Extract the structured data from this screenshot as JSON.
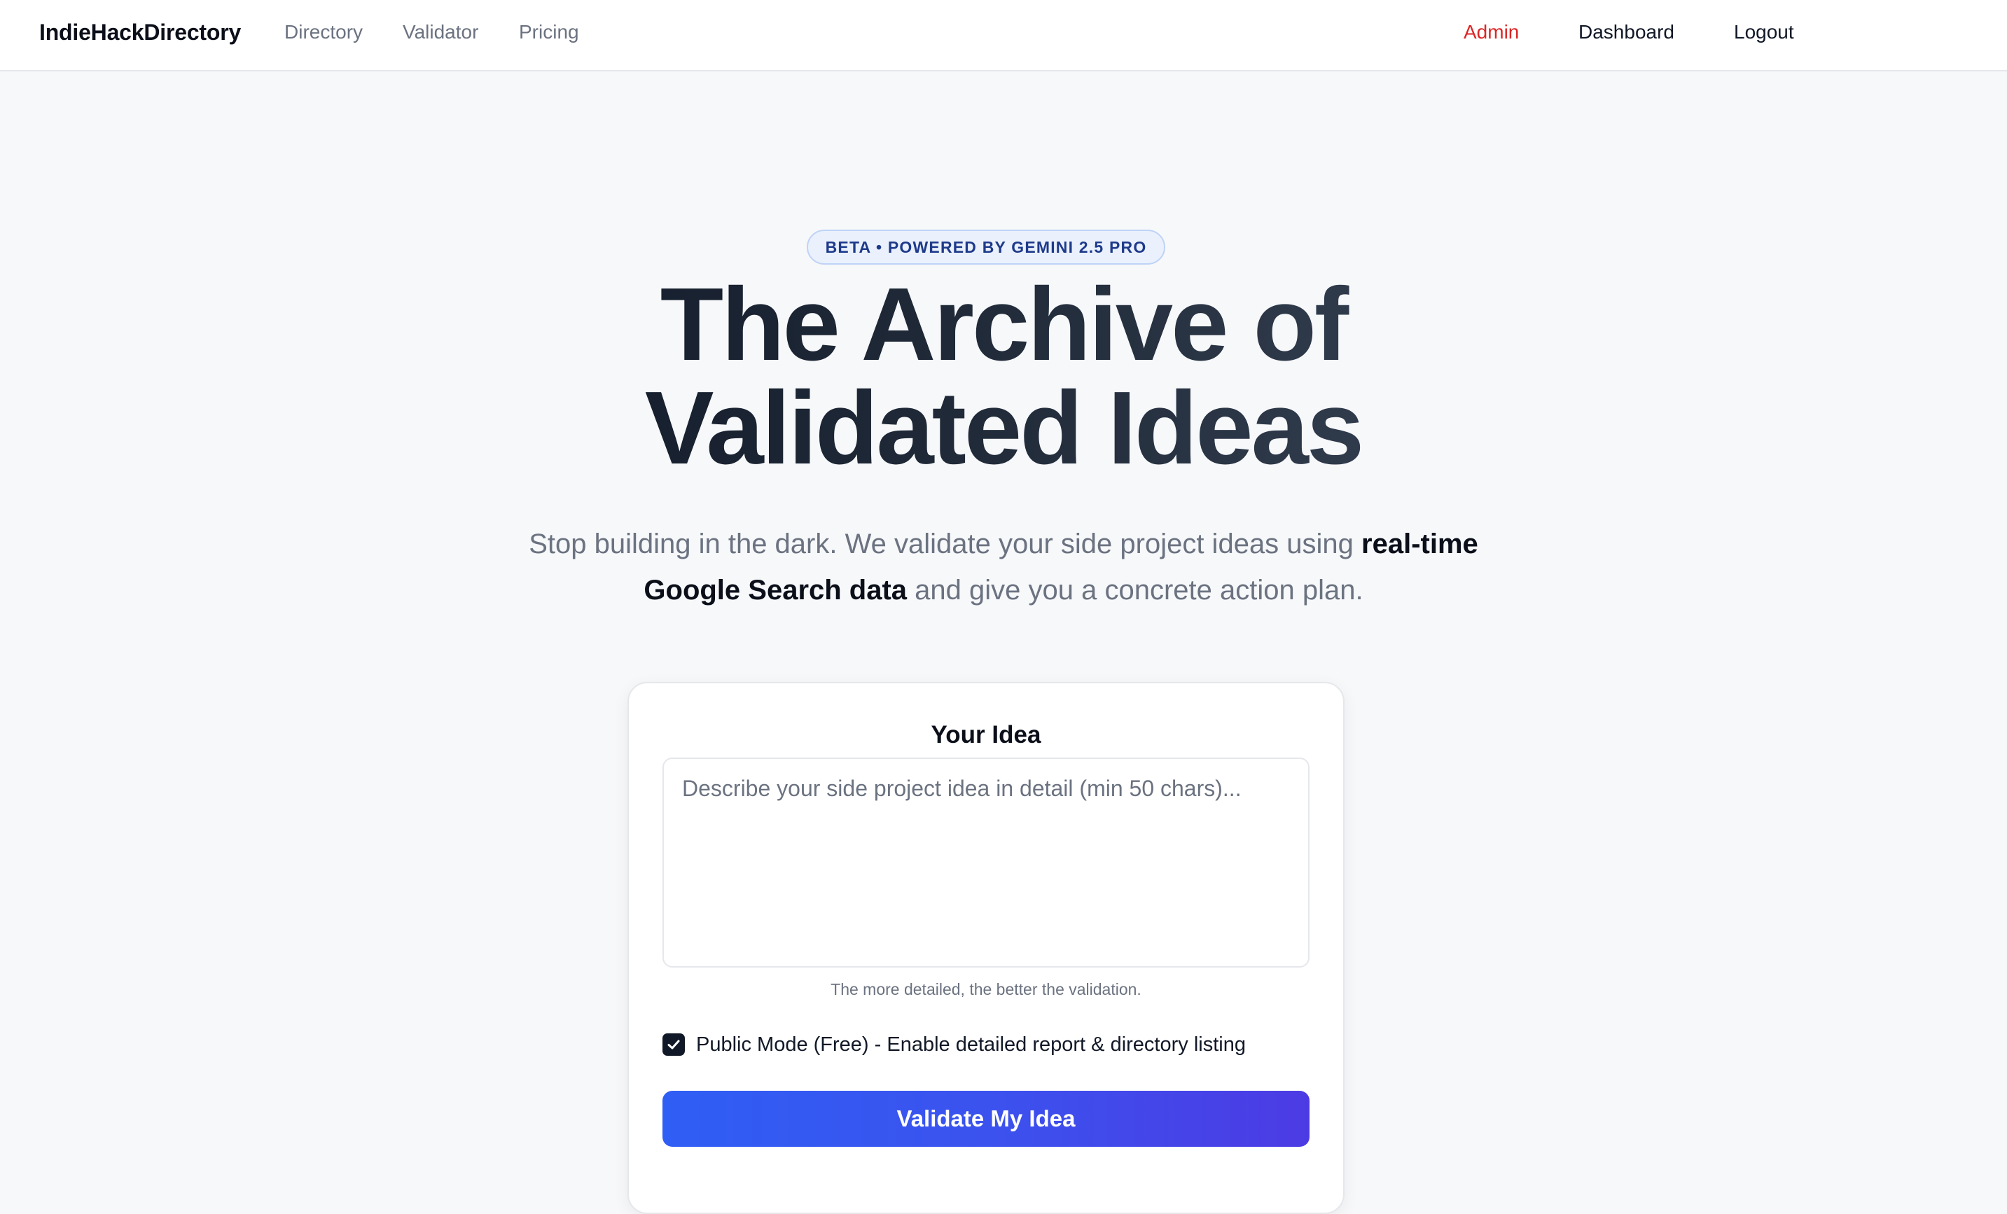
{
  "nav": {
    "brand": "IndieHackDirectory",
    "links": [
      "Directory",
      "Validator",
      "Pricing"
    ],
    "admin": "Admin",
    "dashboard": "Dashboard",
    "logout": "Logout"
  },
  "hero": {
    "badge": "BETA • POWERED BY GEMINI 2.5 PRO",
    "title_line1": "The Archive of",
    "title_line2": "Validated Ideas",
    "subtitle_pre": "Stop building in the dark. We validate your side project ideas using ",
    "subtitle_bold": "real-time Google Search data",
    "subtitle_post": " and give you a concrete action plan."
  },
  "form": {
    "title": "Your Idea",
    "placeholder": "Describe your side project idea in detail (min 50 chars)...",
    "value": "",
    "hint": "The more detailed, the better the validation.",
    "public_mode_label": "Public Mode (Free) - Enable detailed report & directory listing",
    "public_mode_checked": true,
    "submit_label": "Validate My Idea"
  },
  "colors": {
    "admin": "#dc2626",
    "badge_text": "#1e3a8a",
    "button_start": "#2f5ef5",
    "button_end": "#4c3be4"
  },
  "icons": {
    "checkbox": "check-icon"
  }
}
